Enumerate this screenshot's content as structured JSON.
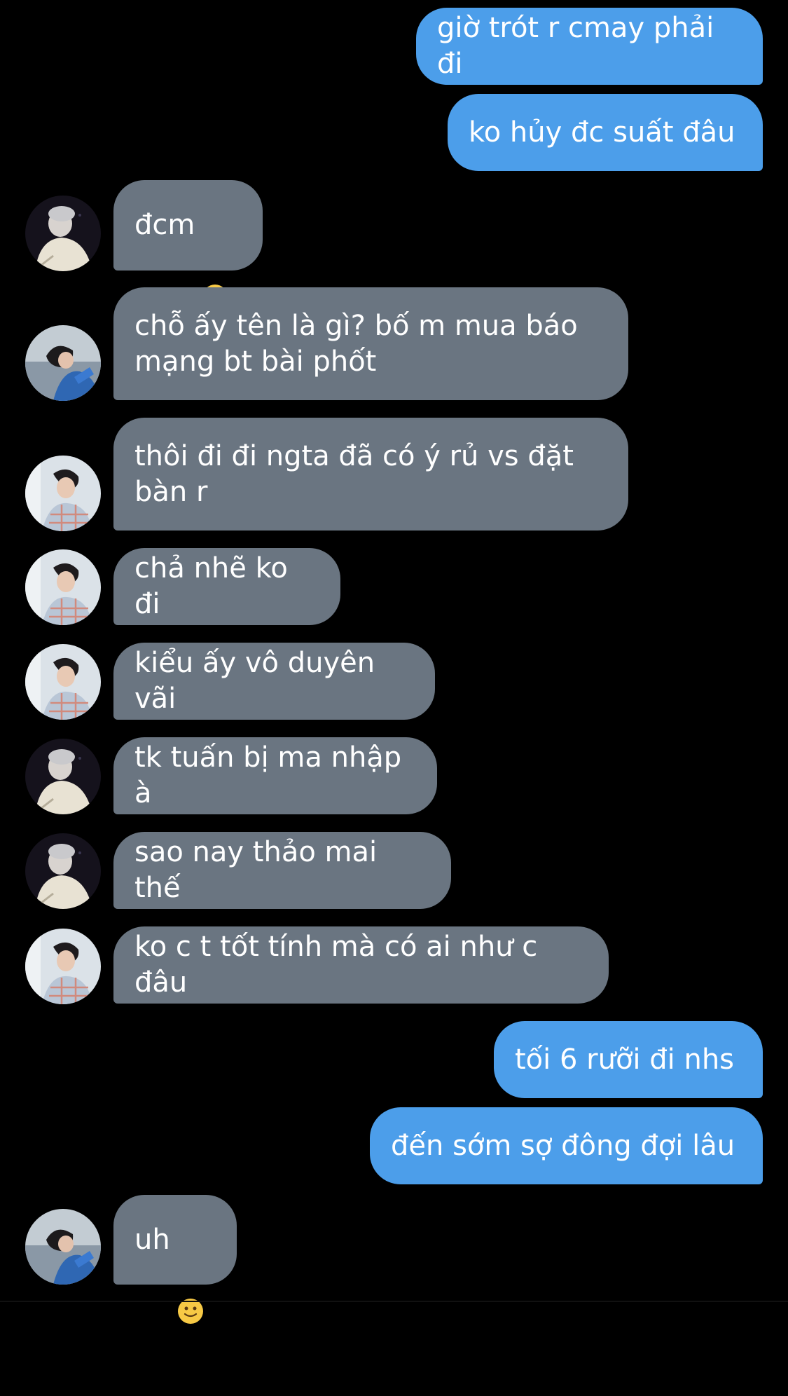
{
  "theme": {
    "background": "#000000",
    "outgoing_bubble": "#4c9eea",
    "incoming_bubble": "#6a7581",
    "text": "#ffffff"
  },
  "messages": [
    {
      "direction": "out",
      "text": "giờ trót r cmay phải đi"
    },
    {
      "direction": "out",
      "text": "ko hủy đc suất đâu"
    },
    {
      "direction": "in",
      "avatar": "avatar-blonde-hair",
      "text": "đcm",
      "emoji": "slightly-smiling-face-emoji"
    },
    {
      "direction": "in",
      "avatar": "avatar-blue-jacket-sea",
      "text": "chỗ ấy tên là gì? bố m mua báo\nmạng bt bài phốt"
    },
    {
      "direction": "in",
      "avatar": "avatar-dark-hair-plaid",
      "text": "thôi đi đi ngta đã có ý rủ vs đặt\nbàn r"
    },
    {
      "direction": "in",
      "avatar": "avatar-dark-hair-plaid",
      "text": "chả nhẽ ko đi"
    },
    {
      "direction": "in",
      "avatar": "avatar-dark-hair-plaid",
      "text": "kiểu ấy vô duyên vãi"
    },
    {
      "direction": "in",
      "avatar": "avatar-blonde-hair",
      "text": "tk tuấn bị ma nhập à"
    },
    {
      "direction": "in",
      "avatar": "avatar-blonde-hair",
      "text": "sao nay thảo mai thế"
    },
    {
      "direction": "in",
      "avatar": "avatar-dark-hair-plaid",
      "text": "ko c t tốt tính mà có ai như c đâu"
    },
    {
      "direction": "out",
      "text": "tối 6 rưỡi đi nhs"
    },
    {
      "direction": "out",
      "text": "đến sớm sợ đông đợi lâu"
    },
    {
      "direction": "in",
      "avatar": "avatar-blue-jacket-sea",
      "text": "uh",
      "emoji": "slightly-smiling-face-emoji"
    }
  ]
}
